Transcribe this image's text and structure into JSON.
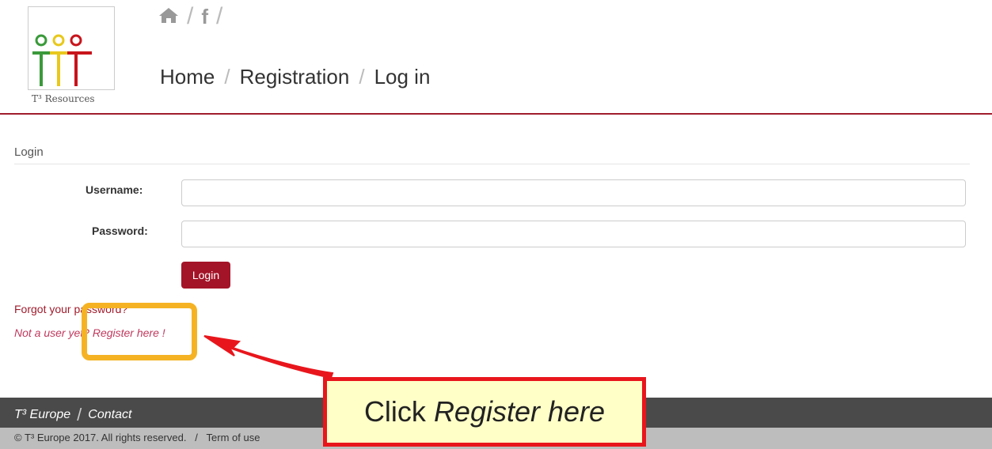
{
  "header": {
    "logo_caption": "T³ Resources",
    "icons": [
      "home-icon",
      "facebook-icon"
    ],
    "breadcrumb": [
      "Home",
      "Registration",
      "Log in"
    ]
  },
  "login": {
    "section_title": "Login",
    "username_label": "Username:",
    "password_label": "Password:",
    "username_value": "",
    "password_value": "",
    "login_button": "Login",
    "forgot_link": "Forgot your password?",
    "register_link": "Not a user yet? Register here !"
  },
  "footer": {
    "brand": "T³ Europe",
    "contact": "Contact",
    "copyright": "© T³ Europe 2017. All rights reserved.",
    "separator": "/",
    "terms": "Term of use"
  },
  "annotation": {
    "callout_prefix": "Click ",
    "callout_emphasis": "Register here"
  },
  "colors": {
    "accent": "#a01c2c",
    "button": "#a31428",
    "highlight_box": "#f5b324",
    "callout_border": "#e8161c",
    "callout_bg": "#ffffc8"
  }
}
